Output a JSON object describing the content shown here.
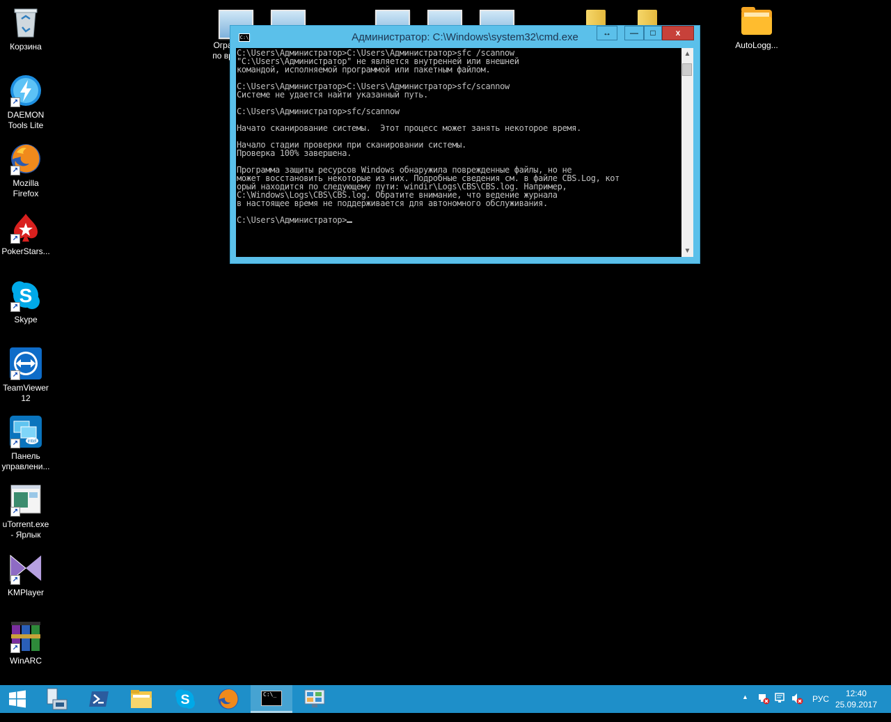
{
  "desktop": {
    "icons": [
      {
        "label": "Корзина",
        "icon": "recycle-bin-icon"
      },
      {
        "label": "DAEMON\nTools Lite",
        "icon": "daemon-tools-icon"
      },
      {
        "label": "Mozilla\nFirefox",
        "icon": "firefox-icon"
      },
      {
        "label": "PokerStars...",
        "icon": "pokerstars-icon"
      },
      {
        "label": "Skype",
        "icon": "skype-icon"
      },
      {
        "label": "TeamViewer\n12",
        "icon": "teamviewer-icon"
      },
      {
        "label": "Панель\nуправлени...",
        "icon": "intel-panel-icon"
      },
      {
        "label": "uTorrent.exe\n- Ярлык",
        "icon": "utorrent-shortcut-icon"
      },
      {
        "label": "KMPlayer",
        "icon": "kmplayer-icon"
      },
      {
        "label": "WinARC",
        "icon": "winarc-icon"
      }
    ],
    "partial_label_line1": "Огра",
    "partial_label_line2": "по вр",
    "autologger_label": "AutoLogg..."
  },
  "cmd_window": {
    "title": "Администратор: C:\\Windows\\system32\\cmd.exe",
    "buttons": {
      "restore_width": "↔",
      "minimize": "—",
      "maximize": "□",
      "close": "x"
    },
    "lines": [
      "C:\\Users\\Администратор>C:\\Users\\Администратор>sfc /scannow",
      "\"C:\\Users\\Администратор\" не является внутренней или внешней",
      "командой, исполняемой программой или пакетным файлом.",
      "",
      "C:\\Users\\Администратор>C:\\Users\\Администратор>sfc/scannow",
      "Системе не удается найти указанный путь.",
      "",
      "C:\\Users\\Администратор>sfc/scannow",
      "",
      "Начато сканирование системы.  Этот процесс может занять некоторое время.",
      "",
      "Начало стадии проверки при сканировании системы.",
      "Проверка 100% завершена.",
      "",
      "Программа защиты ресурсов Windows обнаружила поврежденные файлы, но не",
      "может восстановить некоторые из них. Подробные сведения см. в файле CBS.Log, кот",
      "орый находится по следующему пути: windir\\Logs\\CBS\\CBS.log. Например,",
      "C:\\Windows\\Logs\\CBS\\CBS.log. Обратите внимание, что ведение журнала",
      "в настоящее время не поддерживается для автономного обслуживания.",
      "",
      "C:\\Users\\Администратор>"
    ]
  },
  "taskbar": {
    "items": [
      {
        "name": "start-button",
        "icon": "windows-logo-icon"
      },
      {
        "name": "server-manager",
        "icon": "server-manager-icon"
      },
      {
        "name": "powershell",
        "icon": "powershell-icon"
      },
      {
        "name": "file-explorer",
        "icon": "folder-icon"
      },
      {
        "name": "skype",
        "icon": "skype-icon"
      },
      {
        "name": "firefox",
        "icon": "firefox-icon"
      },
      {
        "name": "cmd",
        "icon": "cmd-icon"
      },
      {
        "name": "control-panel",
        "icon": "control-panel-icon"
      }
    ],
    "tray": {
      "show_hidden": "▲",
      "language": "РУС",
      "time": "12:40",
      "date": "25.09.2017"
    }
  }
}
